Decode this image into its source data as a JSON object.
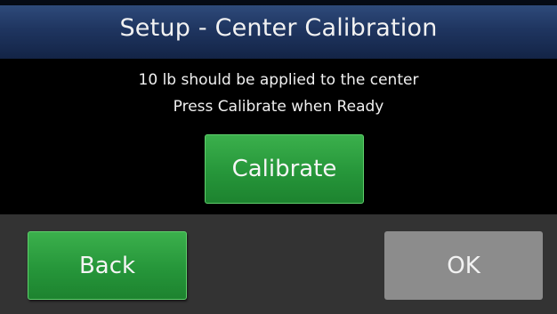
{
  "header": {
    "title": "Setup - Center Calibration"
  },
  "message": {
    "line1": "10 lb should be applied to the center",
    "line2": "Press Calibrate when Ready"
  },
  "actions": {
    "calibrate_label": "Calibrate",
    "back_label": "Back",
    "ok_label": "OK",
    "ok_enabled": false
  },
  "colors": {
    "title_bar": "#1f3560",
    "primary_button": "#26963a",
    "disabled_button": "#8c8c8c",
    "footer": "#333333",
    "background": "#000000"
  }
}
